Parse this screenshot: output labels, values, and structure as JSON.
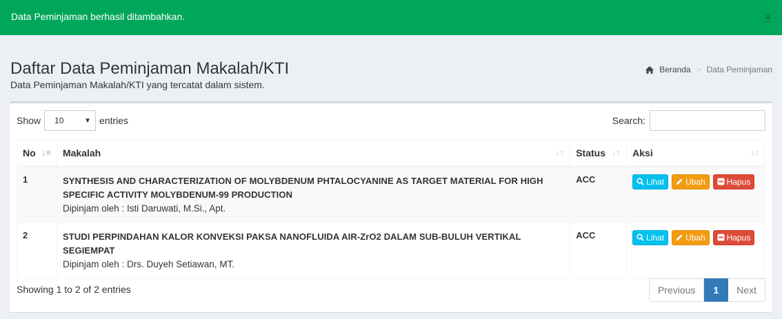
{
  "alert": {
    "message": "Data Peminjaman berhasil ditambahkan.",
    "close": "×"
  },
  "header": {
    "title": "Daftar Data Peminjaman Makalah/KTI",
    "subtitle": "Data Peminjaman Makalah/KTI yang tercatat dalam sistem."
  },
  "breadcrumb": {
    "home": "Beranda",
    "current": "Data Peminjaman"
  },
  "table_controls": {
    "show_label": "Show",
    "entries_label": "entries",
    "length_value": "10",
    "search_label": "Search:"
  },
  "table": {
    "columns": [
      "No",
      "Makalah",
      "Status",
      "Aksi"
    ],
    "rows": [
      {
        "no": "1",
        "title": "SYNTHESIS AND CHARACTERIZATION OF MOLYBDENUM PHTALOCYANINE AS TARGET MATERIAL FOR HIGH SPECIFIC ACTIVITY MOLYBDENUM-99 PRODUCTION",
        "borrower": "Dipinjam oleh : Isti Daruwati, M.Si., Apt.",
        "status": "ACC"
      },
      {
        "no": "2",
        "title": "STUDI PERPINDAHAN KALOR KONVEKSI PAKSA NANOFLUIDA AIR-ZrO2 DALAM SUB-BULUH VERTIKAL SEGIEMPAT",
        "borrower": "Dipinjam oleh : Drs. Duyeh Setiawan, MT.",
        "status": "ACC"
      }
    ],
    "actions": {
      "view": "Lihat",
      "edit": "Ubah",
      "delete": "Hapus"
    }
  },
  "footer": {
    "info": "Showing 1 to 2 of 2 entries",
    "previous": "Previous",
    "page": "1",
    "next": "Next"
  },
  "colors": {
    "alert_bg": "#00a65a",
    "btn_info": "#00c0ef",
    "btn_warning": "#f39c12",
    "btn_danger": "#dd4b39",
    "page_active": "#337ab7"
  }
}
